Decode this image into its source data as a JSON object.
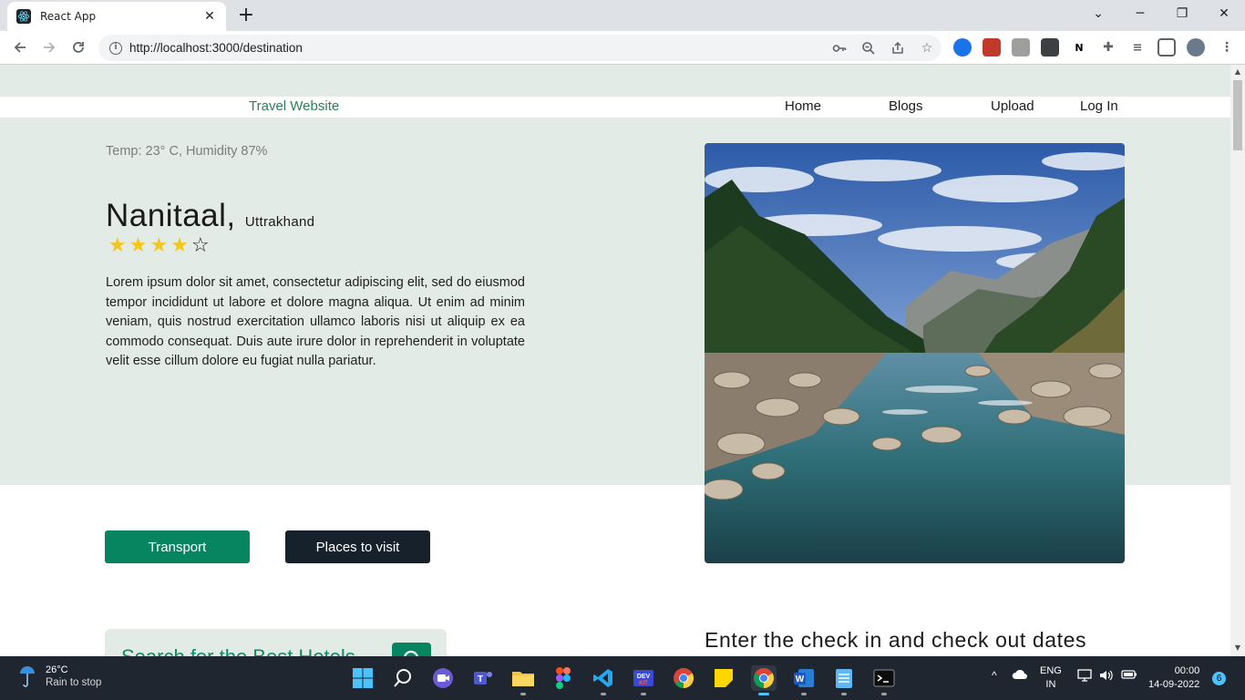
{
  "browser": {
    "tab_title": "React App",
    "new_tab": "+",
    "url": "http://localhost:3000/destination"
  },
  "nav": {
    "brand": "Travel Website",
    "links": [
      "Home",
      "Blogs",
      "Upload",
      "Log In"
    ]
  },
  "destination": {
    "weather": "Temp: 23° C, Humidity 87%",
    "city": "Nanitaal,",
    "state": "Uttrakhand",
    "rating": 4,
    "rating_max": 5,
    "description": "Lorem ipsum dolor sit amet, consectetur adipiscing elit, sed do eiusmod tempor incididunt ut labore et dolore magna aliqua. Ut enim ad minim veniam, quis nostrud exercitation ullamco laboris nisi ut aliquip ex ea commodo consequat. Duis aute irure dolor in reprehenderit in voluptate velit esse cillum dolore eu fugiat nulla pariatur."
  },
  "buttons": {
    "transport": "Transport",
    "places": "Places to visit"
  },
  "hotels": {
    "search_title": "Search for the Best Hotels",
    "checkin_heading": "Enter the check in and check out dates"
  },
  "colors": {
    "accent": "#078561",
    "dark_button": "#16212b",
    "hero_bg": "#e3ebe6",
    "star": "#f5c518"
  },
  "taskbar": {
    "weather_temp": "26°C",
    "weather_cond": "Rain to stop",
    "lang_line1": "ENG",
    "lang_line2": "IN",
    "time": "00:00",
    "date": "14-09-2022",
    "notifications": "6",
    "icons": [
      "windows-start-icon",
      "search-icon",
      "meet-icon",
      "teams-icon",
      "file-explorer-icon",
      "figma-icon",
      "vscode-icon",
      "devkit-icon",
      "chrome-icon",
      "sticky-notes-icon",
      "chrome-dev-icon",
      "word-icon",
      "notepad-icon",
      "terminal-icon"
    ]
  }
}
